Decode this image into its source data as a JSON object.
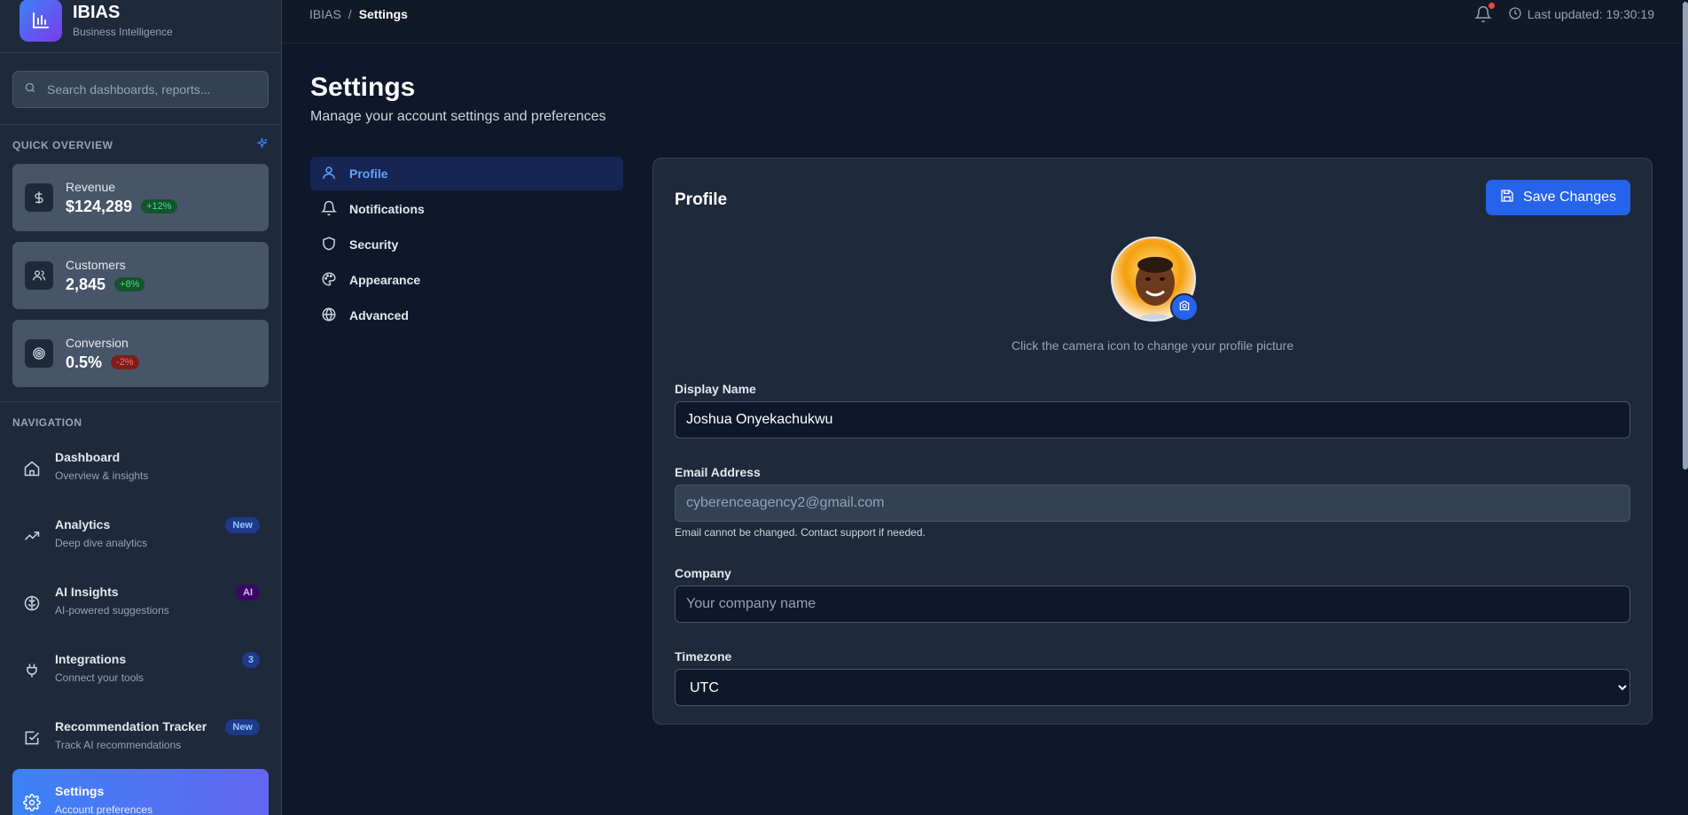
{
  "brand": {
    "name": "IBIAS",
    "subtitle": "Business Intelligence"
  },
  "search": {
    "placeholder": "Search dashboards, reports..."
  },
  "overview": {
    "heading": "QUICK OVERVIEW",
    "stats": [
      {
        "label": "Revenue",
        "value": "$124,289",
        "change": "+12%",
        "icon": "dollar-icon"
      },
      {
        "label": "Customers",
        "value": "2,845",
        "change": "+8%",
        "icon": "users-icon"
      },
      {
        "label": "Conversion",
        "value": "0.5%",
        "change": "-2%",
        "icon": "target-icon"
      }
    ]
  },
  "navigation": {
    "heading": "NAVIGATION",
    "items": [
      {
        "title": "Dashboard",
        "subtitle": "Overview & insights",
        "badge": "",
        "icon": "home-icon"
      },
      {
        "title": "Analytics",
        "subtitle": "Deep dive analytics",
        "badge": "New",
        "icon": "trending-up-icon"
      },
      {
        "title": "AI Insights",
        "subtitle": "AI-powered suggestions",
        "badge": "AI",
        "icon": "brain-icon"
      },
      {
        "title": "Integrations",
        "subtitle": "Connect your tools",
        "badge": "3",
        "icon": "plug-icon"
      },
      {
        "title": "Recommendation Tracker",
        "subtitle": "Track AI recommendations",
        "badge": "New",
        "icon": "check-square-icon"
      },
      {
        "title": "Settings",
        "subtitle": "Account preferences",
        "badge": "",
        "icon": "gear-icon"
      }
    ]
  },
  "breadcrumb": {
    "root": "IBIAS",
    "separator": "/",
    "current": "Settings"
  },
  "topbar": {
    "last_updated": "Last updated: 19:30:19"
  },
  "page": {
    "title": "Settings",
    "subtitle": "Manage your account settings and preferences"
  },
  "tabs": [
    {
      "label": "Profile",
      "icon": "user-icon",
      "active": true
    },
    {
      "label": "Notifications",
      "icon": "bell-icon",
      "active": false
    },
    {
      "label": "Security",
      "icon": "shield-icon",
      "active": false
    },
    {
      "label": "Appearance",
      "icon": "palette-icon",
      "active": false
    },
    {
      "label": "Advanced",
      "icon": "globe-icon",
      "active": false
    }
  ],
  "profile": {
    "title": "Profile",
    "save_label": "Save Changes",
    "avatar_hint": "Click the camera icon to change your profile picture",
    "display_name_label": "Display Name",
    "display_name_value": "Joshua Onyekachukwu",
    "email_label": "Email Address",
    "email_value": "cyberenceagency2@gmail.com",
    "email_help": "Email cannot be changed. Contact support if needed.",
    "company_label": "Company",
    "company_value": "",
    "company_placeholder": "Your company name",
    "timezone_label": "Timezone",
    "timezone_value": "UTC"
  },
  "colors": {
    "accent": "#2563eb",
    "background": "#0f172a",
    "panel": "#1e293b"
  }
}
